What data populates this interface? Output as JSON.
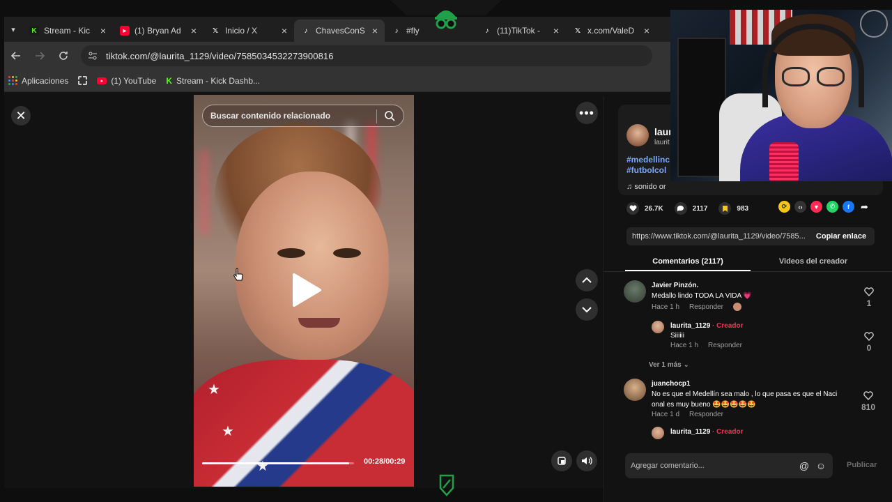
{
  "browser": {
    "tabs": [
      {
        "icon": "kick-icon",
        "label": "Stream - Kic"
      },
      {
        "icon": "youtube-icon",
        "label": "(1) Bryan Ad"
      },
      {
        "icon": "x-icon",
        "label": "Inicio / X"
      },
      {
        "icon": "tiktok-icon",
        "label": "ChavesConS",
        "active": true
      },
      {
        "icon": "tiktok-icon",
        "label": "#fly"
      },
      {
        "icon": "tiktok-icon",
        "label": "(11)TikTok -"
      },
      {
        "icon": "x-icon",
        "label": "x.com/ValeD"
      }
    ],
    "url": "tiktok.com/@laurita_1129/video/7585034532273900816",
    "bookmarks": [
      {
        "label": "Aplicaciones"
      },
      {
        "label": "(1) YouTube"
      },
      {
        "label": "Stream - Kick Dashb..."
      }
    ]
  },
  "video": {
    "search_placeholder": "Buscar contenido relacionado",
    "time": "00:28/00:29",
    "progress": 0.97
  },
  "author": {
    "name": "laur",
    "handle": "laurit",
    "hashtags": [
      "#medellinc",
      "#futbolcol"
    ],
    "sound": "sonido or"
  },
  "stats": {
    "likes": "26.7K",
    "comments": "2117",
    "saves": "983"
  },
  "share_link": {
    "url": "https://www.tiktok.com/@laurita_1129/video/7585...",
    "copy_label": "Copiar enlace"
  },
  "panel_tabs": {
    "comments": "Comentarios (2117)",
    "creator_videos": "Videos del creador"
  },
  "comments": [
    {
      "name": "Javier Pinzón.",
      "text": "Medallo lindo TODA LA VIDA 💗",
      "time": "Hace 1 h",
      "reply": "Responder",
      "likes": "1"
    },
    {
      "name": "laurita_1129",
      "creator": "· Creador",
      "text": "Siiiiii",
      "time": "Hace 1 h",
      "reply": "Responder",
      "likes": "0"
    },
    {
      "name": "juanchocp1",
      "text": "No es que el Medellín sea malo , lo que pasa es que el Naci",
      "text2": "onal es muy bueno 🤩🤩🤩🤩🤩",
      "time": "Hace 1 d",
      "reply": "Responder",
      "likes": "810"
    },
    {
      "name": "laurita_1129",
      "creator": "· Creador"
    }
  ],
  "view_more": "Ver 1 más",
  "comment_input": {
    "placeholder": "Agregar comentario...",
    "publish": "Publicar"
  },
  "colors": {
    "tiktok_red": "#fe2c55",
    "hashtag_blue": "#7aa7ff",
    "kick_green": "#53fc18"
  }
}
